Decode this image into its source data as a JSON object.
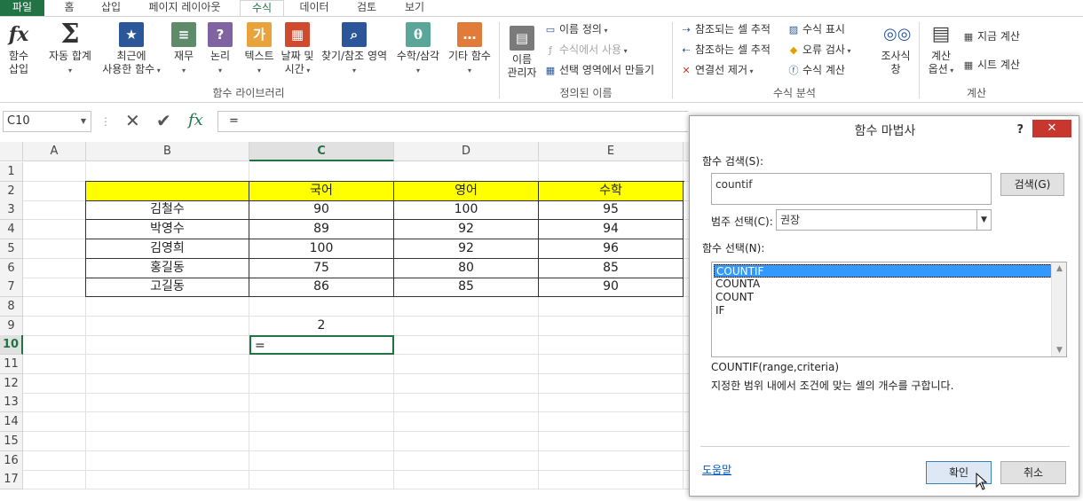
{
  "tabs": [
    "파일",
    "홈",
    "삽입",
    "페이지 레이아웃",
    "수식",
    "데이터",
    "검토",
    "보기"
  ],
  "ribbon": {
    "insert_function": [
      "함수",
      "삽입"
    ],
    "autosum": "자동 합계",
    "recent": [
      "최근에",
      "사용한 함수"
    ],
    "financial": "재무",
    "logical": "논리",
    "text": "텍스트",
    "datetime": [
      "날짜 및",
      "시간"
    ],
    "lookup": "찾기/참조 영역",
    "math": "수학/삼각",
    "more": "기타 함수",
    "group_library": "함수 라이브러리",
    "name_manager": [
      "이름",
      "관리자"
    ],
    "define_name": "이름 정의",
    "use_in_formula": "수식에서 사용",
    "create_from_sel": "선택 영역에서 만들기",
    "group_defined": "정의된 이름",
    "trace_precedents": "참조되는 셀 추적",
    "trace_dependents": "참조하는 셀 추적",
    "remove_arrows": "연결선 제거",
    "show_formulas": "수식 표시",
    "error_checking": "오류 검사",
    "evaluate_formula": "수식 계산",
    "watch_window": [
      "조사식",
      "창"
    ],
    "group_auditing": "수식 분석",
    "calc_options": [
      "계산",
      "옵션"
    ],
    "calc_now": "지금 계산",
    "calc_sheet": "시트 계산",
    "group_calc": "계산"
  },
  "formula_bar": {
    "name_box": "C10",
    "formula": "="
  },
  "sheet": {
    "columns": [
      "A",
      "B",
      "C",
      "D",
      "E"
    ],
    "rows": [
      "1",
      "2",
      "3",
      "4",
      "5",
      "6",
      "7",
      "8",
      "9",
      "10",
      "11",
      "12",
      "13",
      "14",
      "15",
      "16",
      "17"
    ],
    "header": [
      "국어",
      "영어",
      "수학"
    ],
    "table": [
      [
        "김철수",
        "90",
        "100",
        "95"
      ],
      [
        "박영수",
        "89",
        "92",
        "94"
      ],
      [
        "김영희",
        "100",
        "92",
        "96"
      ],
      [
        "홍길동",
        "75",
        "80",
        "85"
      ],
      [
        "고길동",
        "86",
        "85",
        "90"
      ]
    ],
    "c9": "2",
    "c10": "="
  },
  "dialog": {
    "title": "함수 마법사",
    "help": "?",
    "search_label": "함수 검색(S):",
    "search_value": "countif",
    "search_button": "검색(G)",
    "category_label": "범주 선택(C):",
    "category_value": "권장",
    "select_label": "함수 선택(N):",
    "functions": [
      "COUNTIF",
      "COUNTA",
      "COUNT",
      "IF"
    ],
    "signature": "COUNTIF(range,criteria)",
    "description": "지정한 범위 내에서 조건에 맞는 셀의 개수를 구합니다.",
    "help_link": "도움말",
    "ok": "확인",
    "cancel": "취소"
  },
  "colors": {
    "excel_green": "#217346",
    "header_yellow": "#ffff00",
    "close_red": "#c7372f",
    "list_select": "#3399ff"
  }
}
